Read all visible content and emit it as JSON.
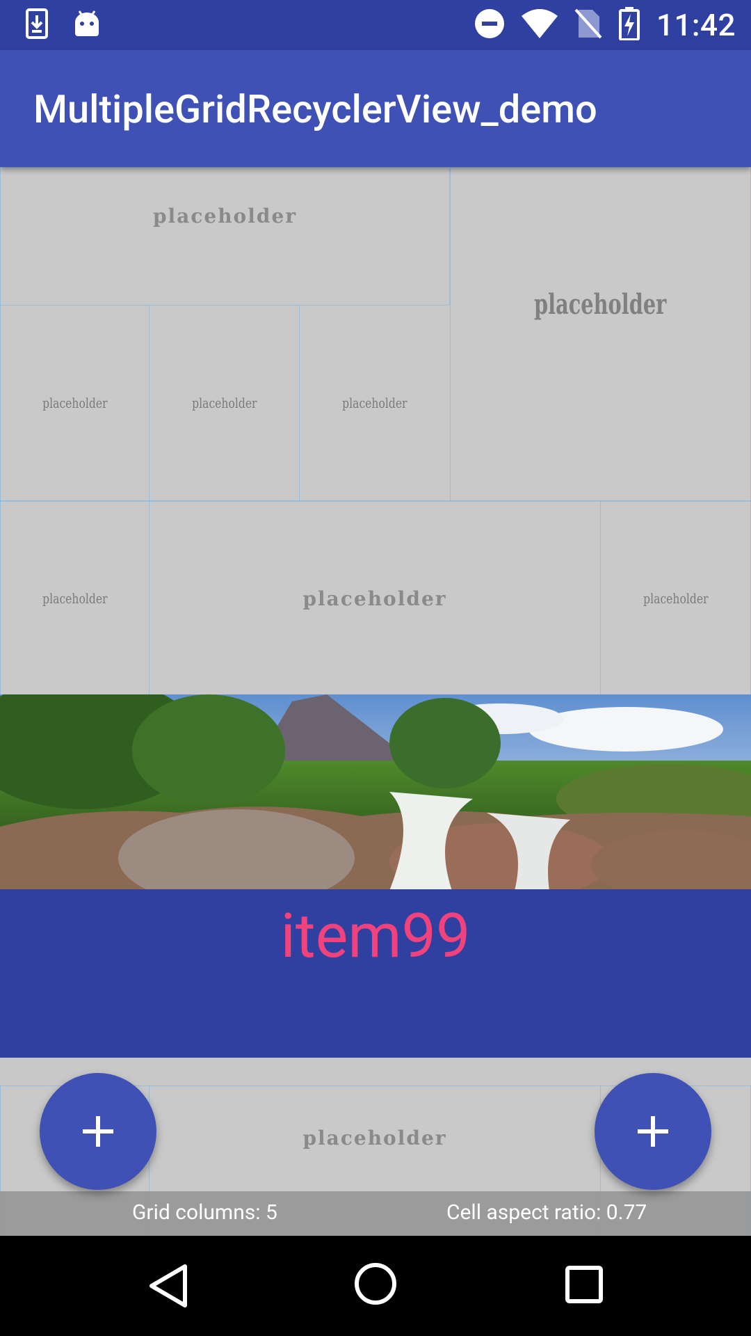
{
  "status_bar": {
    "time": "11:42",
    "icons": [
      "download-icon",
      "android-icon",
      "do-not-disturb-icon",
      "wifi-icon",
      "no-sim-icon",
      "battery-charging-icon"
    ]
  },
  "app_bar": {
    "title": "MultipleGridRecyclerView_demo"
  },
  "grid": {
    "placeholder_text": "placeholder",
    "cells": [
      "placeholder",
      "placeholder",
      "placeholder",
      "placeholder",
      "placeholder",
      "placeholder",
      "placeholder",
      "placeholder",
      "placeholder",
      "placeholder",
      "placeholder"
    ]
  },
  "featured_item": {
    "label": "item99",
    "label_color": "#F0427C",
    "label_bg": "#3040A0"
  },
  "info_bar": {
    "grid_columns": "Grid columns: 5",
    "cell_aspect_ratio": "Cell aspect ratio: 0.77"
  },
  "fabs": [
    {
      "icon": "plus-icon"
    },
    {
      "icon": "plus-icon"
    }
  ],
  "nav_bar": {
    "buttons": [
      "back-icon",
      "home-icon",
      "recents-icon"
    ]
  },
  "colors": {
    "primary": "#3F51B5",
    "primary_dark": "#3040A0",
    "accent": "#F0427C"
  }
}
